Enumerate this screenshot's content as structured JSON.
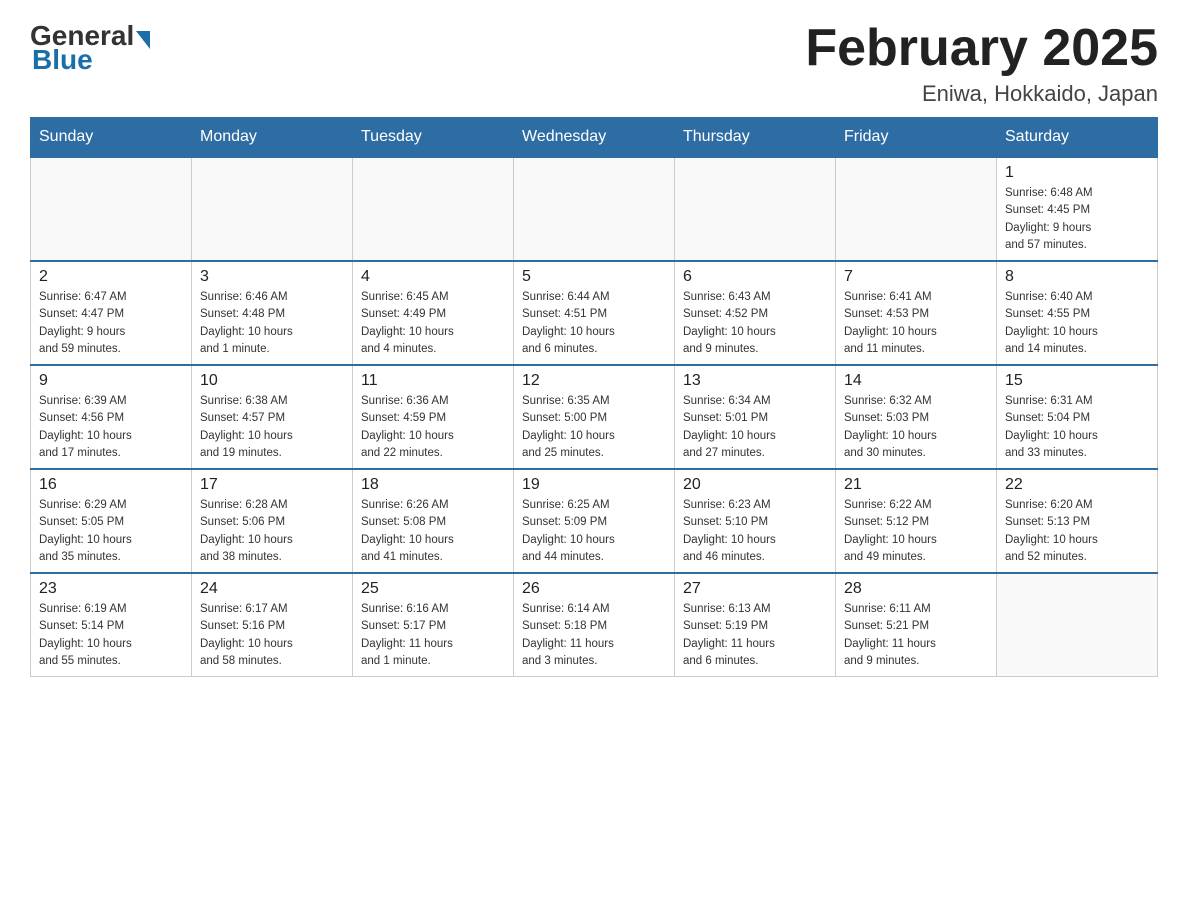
{
  "header": {
    "logo_general": "General",
    "logo_blue": "Blue",
    "month_title": "February 2025",
    "location": "Eniwa, Hokkaido, Japan"
  },
  "weekdays": [
    "Sunday",
    "Monday",
    "Tuesday",
    "Wednesday",
    "Thursday",
    "Friday",
    "Saturday"
  ],
  "weeks": [
    [
      {
        "day": "",
        "info": ""
      },
      {
        "day": "",
        "info": ""
      },
      {
        "day": "",
        "info": ""
      },
      {
        "day": "",
        "info": ""
      },
      {
        "day": "",
        "info": ""
      },
      {
        "day": "",
        "info": ""
      },
      {
        "day": "1",
        "info": "Sunrise: 6:48 AM\nSunset: 4:45 PM\nDaylight: 9 hours\nand 57 minutes."
      }
    ],
    [
      {
        "day": "2",
        "info": "Sunrise: 6:47 AM\nSunset: 4:47 PM\nDaylight: 9 hours\nand 59 minutes."
      },
      {
        "day": "3",
        "info": "Sunrise: 6:46 AM\nSunset: 4:48 PM\nDaylight: 10 hours\nand 1 minute."
      },
      {
        "day": "4",
        "info": "Sunrise: 6:45 AM\nSunset: 4:49 PM\nDaylight: 10 hours\nand 4 minutes."
      },
      {
        "day": "5",
        "info": "Sunrise: 6:44 AM\nSunset: 4:51 PM\nDaylight: 10 hours\nand 6 minutes."
      },
      {
        "day": "6",
        "info": "Sunrise: 6:43 AM\nSunset: 4:52 PM\nDaylight: 10 hours\nand 9 minutes."
      },
      {
        "day": "7",
        "info": "Sunrise: 6:41 AM\nSunset: 4:53 PM\nDaylight: 10 hours\nand 11 minutes."
      },
      {
        "day": "8",
        "info": "Sunrise: 6:40 AM\nSunset: 4:55 PM\nDaylight: 10 hours\nand 14 minutes."
      }
    ],
    [
      {
        "day": "9",
        "info": "Sunrise: 6:39 AM\nSunset: 4:56 PM\nDaylight: 10 hours\nand 17 minutes."
      },
      {
        "day": "10",
        "info": "Sunrise: 6:38 AM\nSunset: 4:57 PM\nDaylight: 10 hours\nand 19 minutes."
      },
      {
        "day": "11",
        "info": "Sunrise: 6:36 AM\nSunset: 4:59 PM\nDaylight: 10 hours\nand 22 minutes."
      },
      {
        "day": "12",
        "info": "Sunrise: 6:35 AM\nSunset: 5:00 PM\nDaylight: 10 hours\nand 25 minutes."
      },
      {
        "day": "13",
        "info": "Sunrise: 6:34 AM\nSunset: 5:01 PM\nDaylight: 10 hours\nand 27 minutes."
      },
      {
        "day": "14",
        "info": "Sunrise: 6:32 AM\nSunset: 5:03 PM\nDaylight: 10 hours\nand 30 minutes."
      },
      {
        "day": "15",
        "info": "Sunrise: 6:31 AM\nSunset: 5:04 PM\nDaylight: 10 hours\nand 33 minutes."
      }
    ],
    [
      {
        "day": "16",
        "info": "Sunrise: 6:29 AM\nSunset: 5:05 PM\nDaylight: 10 hours\nand 35 minutes."
      },
      {
        "day": "17",
        "info": "Sunrise: 6:28 AM\nSunset: 5:06 PM\nDaylight: 10 hours\nand 38 minutes."
      },
      {
        "day": "18",
        "info": "Sunrise: 6:26 AM\nSunset: 5:08 PM\nDaylight: 10 hours\nand 41 minutes."
      },
      {
        "day": "19",
        "info": "Sunrise: 6:25 AM\nSunset: 5:09 PM\nDaylight: 10 hours\nand 44 minutes."
      },
      {
        "day": "20",
        "info": "Sunrise: 6:23 AM\nSunset: 5:10 PM\nDaylight: 10 hours\nand 46 minutes."
      },
      {
        "day": "21",
        "info": "Sunrise: 6:22 AM\nSunset: 5:12 PM\nDaylight: 10 hours\nand 49 minutes."
      },
      {
        "day": "22",
        "info": "Sunrise: 6:20 AM\nSunset: 5:13 PM\nDaylight: 10 hours\nand 52 minutes."
      }
    ],
    [
      {
        "day": "23",
        "info": "Sunrise: 6:19 AM\nSunset: 5:14 PM\nDaylight: 10 hours\nand 55 minutes."
      },
      {
        "day": "24",
        "info": "Sunrise: 6:17 AM\nSunset: 5:16 PM\nDaylight: 10 hours\nand 58 minutes."
      },
      {
        "day": "25",
        "info": "Sunrise: 6:16 AM\nSunset: 5:17 PM\nDaylight: 11 hours\nand 1 minute."
      },
      {
        "day": "26",
        "info": "Sunrise: 6:14 AM\nSunset: 5:18 PM\nDaylight: 11 hours\nand 3 minutes."
      },
      {
        "day": "27",
        "info": "Sunrise: 6:13 AM\nSunset: 5:19 PM\nDaylight: 11 hours\nand 6 minutes."
      },
      {
        "day": "28",
        "info": "Sunrise: 6:11 AM\nSunset: 5:21 PM\nDaylight: 11 hours\nand 9 minutes."
      },
      {
        "day": "",
        "info": ""
      }
    ]
  ]
}
